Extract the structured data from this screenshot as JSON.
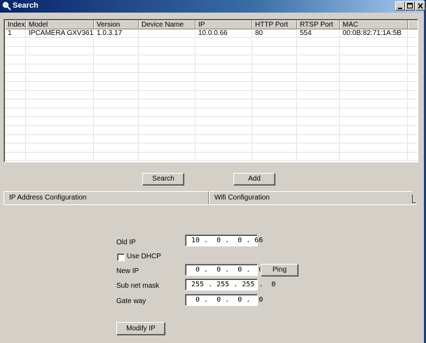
{
  "window": {
    "title": "Search"
  },
  "table": {
    "columns": [
      "Index",
      "Model",
      "Version",
      "Device Name",
      "IP",
      "HTTP Port",
      "RTSP Port",
      "MAC"
    ],
    "rows": [
      [
        "1",
        "IPCAMERA GXV361...",
        "1.0.3.17",
        "",
        "10.0.0.66",
        "80",
        "554",
        "00:0B:82:71:1A:5B"
      ]
    ]
  },
  "buttons": {
    "search": "Search",
    "add": "Add",
    "ping": "Ping",
    "modify_ip": "Modify IP"
  },
  "tabs": [
    "IP Address Configuration",
    "Wifi Configuration"
  ],
  "config": {
    "old_ip_label": "Old IP",
    "old_ip": "10 .  0 .  0 . 66",
    "use_dhcp_label": "Use DHCP",
    "use_dhcp": false,
    "new_ip_label": "New IP",
    "new_ip": " 0 .  0 .  0 .  0",
    "subnet_label": "Sub net mask",
    "subnet": "255 . 255 . 255 .  0",
    "gateway_label": "Gate way",
    "gateway": " 0 .  0 .  0 .  0"
  },
  "icons": {
    "title": "search-icon",
    "minimize": "minimize-icon",
    "maximize": "maximize-icon",
    "close": "close-icon"
  },
  "colors": {
    "titlebar_start": "#0a246a",
    "titlebar_end": "#a6caf0",
    "face": "#d4d0c8"
  }
}
